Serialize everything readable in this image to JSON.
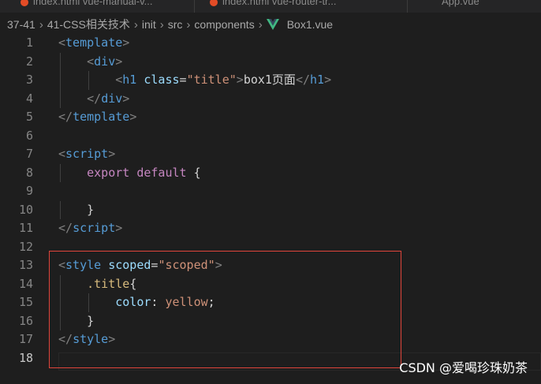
{
  "tabs": [
    {
      "label": "index.html  vue-manual-v..."
    },
    {
      "label": "index.html  vue-router-tr..."
    },
    {
      "label": "App.vue"
    }
  ],
  "breadcrumb": {
    "items": [
      "37-41",
      "41-CSS相关技术",
      "init",
      "src",
      "components"
    ],
    "file": "Box1.vue"
  },
  "editor": {
    "active_line": 18,
    "line_numbers": [
      "1",
      "2",
      "3",
      "4",
      "5",
      "6",
      "7",
      "8",
      "9",
      "10",
      "11",
      "12",
      "13",
      "14",
      "15",
      "16",
      "17",
      "18"
    ],
    "lines": [
      {
        "t": [
          {
            "c": "br",
            "v": "<"
          },
          {
            "c": "tag",
            "v": "template"
          },
          {
            "c": "br",
            "v": ">"
          }
        ]
      },
      {
        "t": [
          {
            "c": "txt",
            "v": "    "
          },
          {
            "c": "br",
            "v": "<"
          },
          {
            "c": "tag",
            "v": "div"
          },
          {
            "c": "br",
            "v": ">"
          }
        ]
      },
      {
        "t": [
          {
            "c": "txt",
            "v": "        "
          },
          {
            "c": "br",
            "v": "<"
          },
          {
            "c": "tag",
            "v": "h1"
          },
          {
            "c": "txt",
            "v": " "
          },
          {
            "c": "attr",
            "v": "class"
          },
          {
            "c": "txt",
            "v": "="
          },
          {
            "c": "str",
            "v": "\"title\""
          },
          {
            "c": "br",
            "v": ">"
          },
          {
            "c": "txt",
            "v": "box1页面"
          },
          {
            "c": "br",
            "v": "</"
          },
          {
            "c": "tag",
            "v": "h1"
          },
          {
            "c": "br",
            "v": ">"
          }
        ]
      },
      {
        "t": [
          {
            "c": "txt",
            "v": "    "
          },
          {
            "c": "br",
            "v": "</"
          },
          {
            "c": "tag",
            "v": "div"
          },
          {
            "c": "br",
            "v": ">"
          }
        ]
      },
      {
        "t": [
          {
            "c": "br",
            "v": "</"
          },
          {
            "c": "tag",
            "v": "template"
          },
          {
            "c": "br",
            "v": ">"
          }
        ]
      },
      {
        "t": []
      },
      {
        "t": [
          {
            "c": "br",
            "v": "<"
          },
          {
            "c": "tag",
            "v": "script"
          },
          {
            "c": "br",
            "v": ">"
          }
        ]
      },
      {
        "t": [
          {
            "c": "txt",
            "v": "    "
          },
          {
            "c": "kw",
            "v": "export"
          },
          {
            "c": "txt",
            "v": " "
          },
          {
            "c": "kw",
            "v": "default"
          },
          {
            "c": "txt",
            "v": " {"
          }
        ]
      },
      {
        "t": []
      },
      {
        "t": [
          {
            "c": "txt",
            "v": "    }"
          }
        ]
      },
      {
        "t": [
          {
            "c": "br",
            "v": "</"
          },
          {
            "c": "tag",
            "v": "script"
          },
          {
            "c": "br",
            "v": ">"
          }
        ]
      },
      {
        "t": []
      },
      {
        "t": [
          {
            "c": "br",
            "v": "<"
          },
          {
            "c": "tag",
            "v": "style"
          },
          {
            "c": "txt",
            "v": " "
          },
          {
            "c": "attr",
            "v": "scoped"
          },
          {
            "c": "txt",
            "v": "="
          },
          {
            "c": "str",
            "v": "\"scoped\""
          },
          {
            "c": "br",
            "v": ">"
          }
        ]
      },
      {
        "t": [
          {
            "c": "txt",
            "v": "    "
          },
          {
            "c": "sel",
            "v": ".title"
          },
          {
            "c": "txt",
            "v": "{"
          }
        ]
      },
      {
        "t": [
          {
            "c": "txt",
            "v": "        "
          },
          {
            "c": "prop",
            "v": "color"
          },
          {
            "c": "txt",
            "v": ": "
          },
          {
            "c": "str",
            "v": "yellow"
          },
          {
            "c": "txt",
            "v": ";"
          }
        ]
      },
      {
        "t": [
          {
            "c": "txt",
            "v": "    }"
          }
        ]
      },
      {
        "t": [
          {
            "c": "br",
            "v": "</"
          },
          {
            "c": "tag",
            "v": "style"
          },
          {
            "c": "br",
            "v": ">"
          }
        ]
      },
      {
        "t": []
      }
    ]
  },
  "watermark": "CSDN @爱喝珍珠奶茶",
  "colors": {
    "background": "#1e1e1e",
    "highlight_box": "#e0453b",
    "vue_green": "#41b883"
  },
  "icons": {
    "file_icon": "vue-logo-icon"
  }
}
